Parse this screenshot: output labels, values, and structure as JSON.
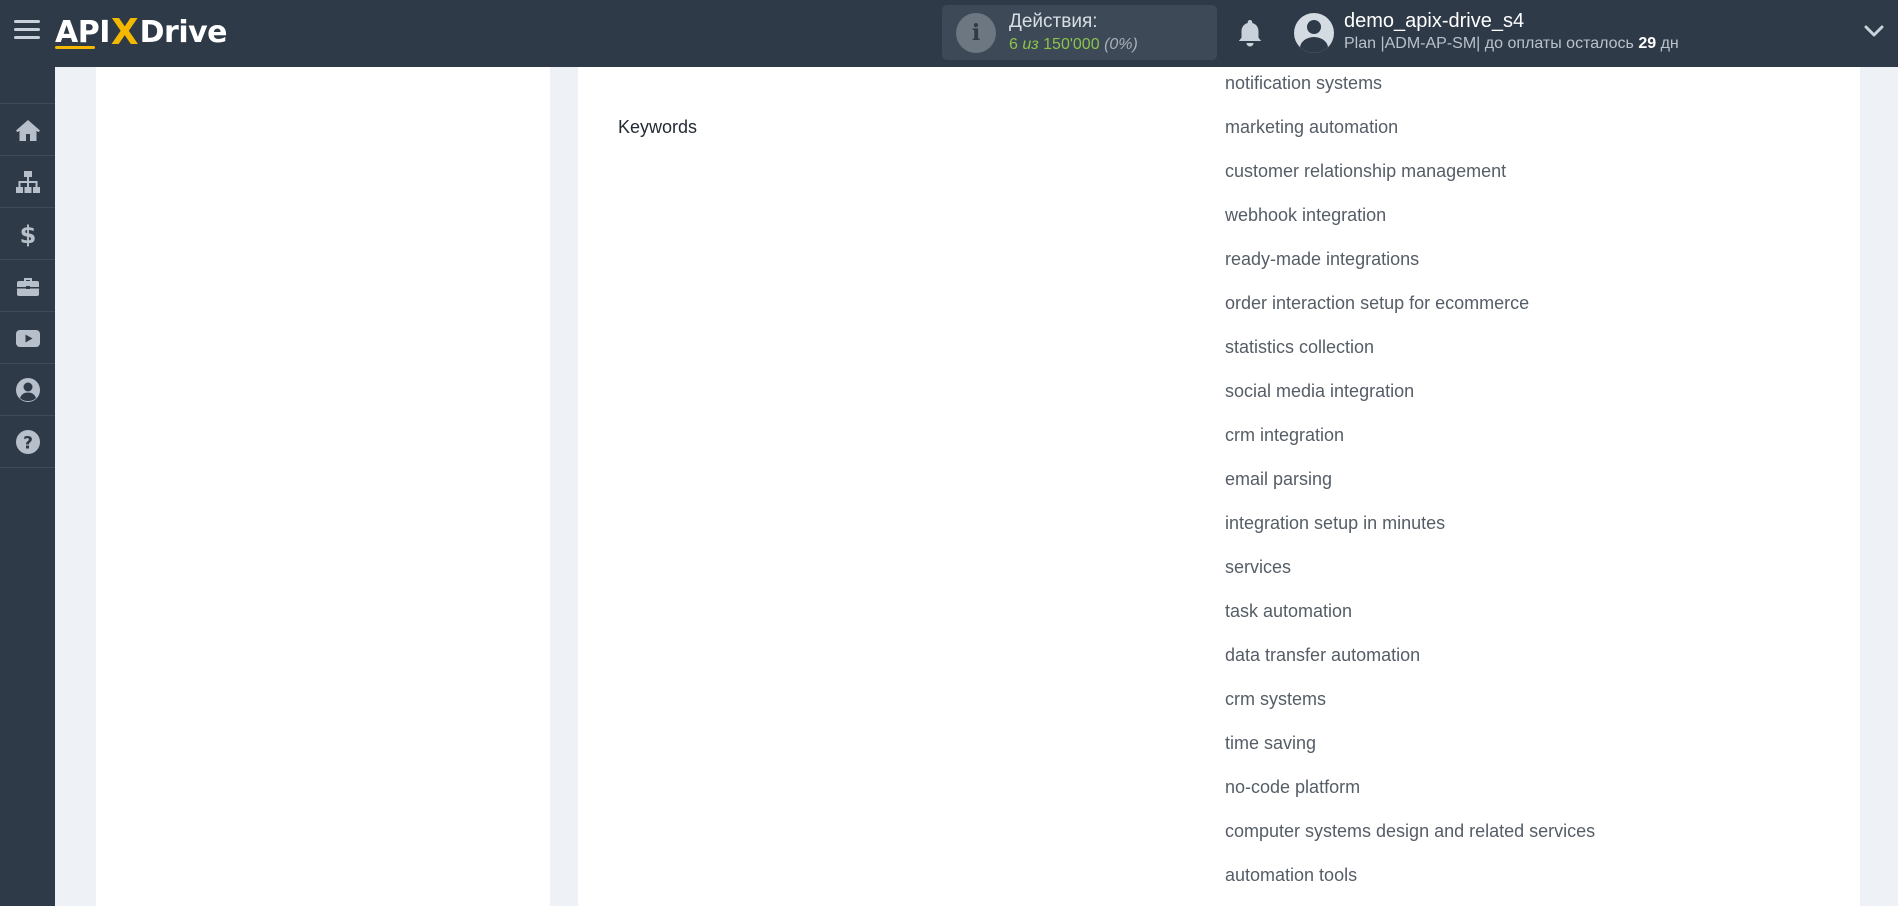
{
  "header": {
    "logo": {
      "part1": "API",
      "x": "X",
      "part2": "Drive"
    },
    "actions": {
      "title": "Действия:",
      "used": "6",
      "of_label": "из",
      "limit": "150'000",
      "percent": "(0%)"
    },
    "user": {
      "name": "demo_apix-drive_s4",
      "plan_prefix": "Plan |ADM-AP-SM| до оплаты осталось",
      "days": "29",
      "days_unit": "дн"
    }
  },
  "sidebar": {
    "items": [
      {
        "name": "home",
        "icon": "home-icon"
      },
      {
        "name": "connections",
        "icon": "sitemap-icon"
      },
      {
        "name": "billing",
        "icon": "dollar-icon"
      },
      {
        "name": "services",
        "icon": "briefcase-icon"
      },
      {
        "name": "video",
        "icon": "youtube-icon"
      },
      {
        "name": "account",
        "icon": "user-circle-icon"
      },
      {
        "name": "help",
        "icon": "question-circle-icon"
      }
    ]
  },
  "main": {
    "keywords_label": "Keywords",
    "keywords": [
      "notification systems",
      "marketing automation",
      "customer relationship management",
      "webhook integration",
      "ready-made integrations",
      "order interaction setup for ecommerce",
      "statistics collection",
      "social media integration",
      "crm integration",
      "email parsing",
      "integration setup in minutes",
      "services",
      "task automation",
      "data transfer automation",
      "crm systems",
      "time saving",
      "no-code platform",
      "computer systems design and related services",
      "automation tools"
    ]
  },
  "colors": {
    "header_bg": "#2e3a48",
    "accent_yellow": "#f5b800",
    "stats_green": "#8bc34a",
    "page_bg": "#eef1f5"
  }
}
